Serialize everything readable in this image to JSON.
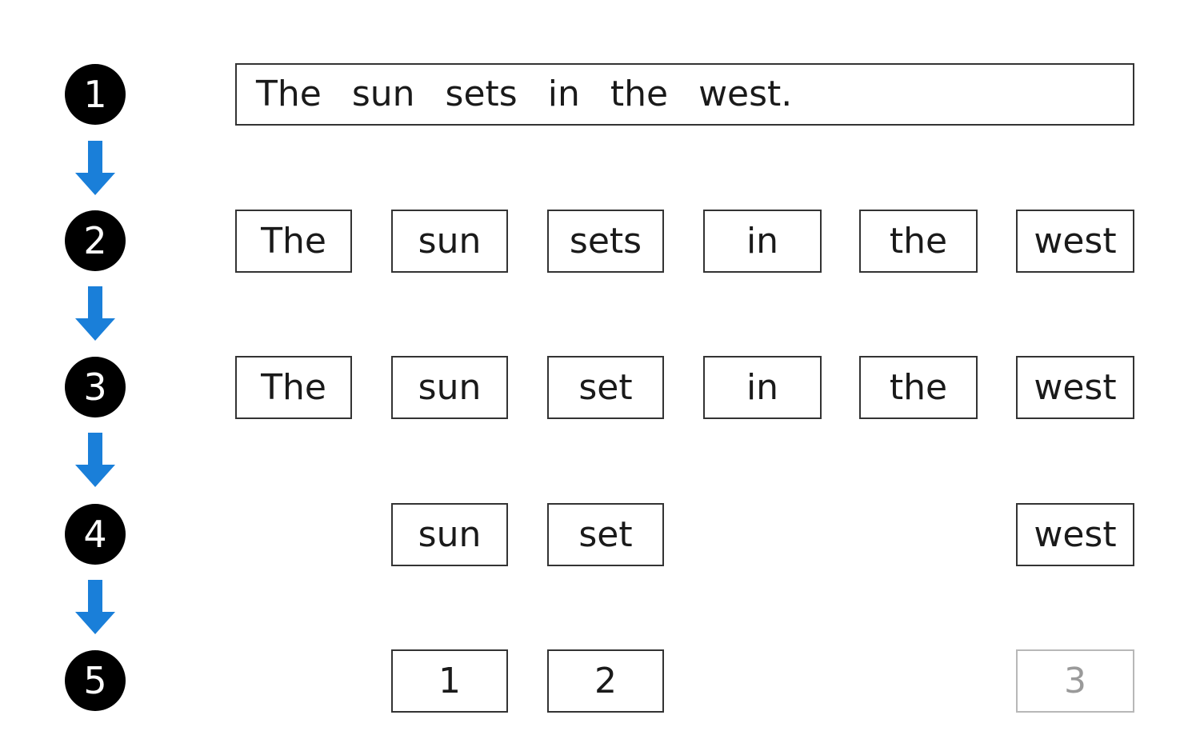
{
  "colors": {
    "arrow": "#1a7fd9",
    "circle": "#000000",
    "box_border": "#333333",
    "faded_border": "#b8b8b8"
  },
  "steps": [
    "1",
    "2",
    "3",
    "4",
    "5"
  ],
  "row1": {
    "sentence_words": [
      "The",
      "sun",
      "sets",
      "in",
      "the",
      "west."
    ]
  },
  "row2": {
    "tokens": [
      "The",
      "sun",
      "sets",
      "in",
      "the",
      "west"
    ]
  },
  "row3": {
    "tokens": [
      "The",
      "sun",
      "set",
      "in",
      "the",
      "west"
    ]
  },
  "row4": {
    "tokens": [
      "sun",
      "set",
      "west"
    ]
  },
  "row5": {
    "ids": [
      "1",
      "2",
      "3"
    ]
  }
}
